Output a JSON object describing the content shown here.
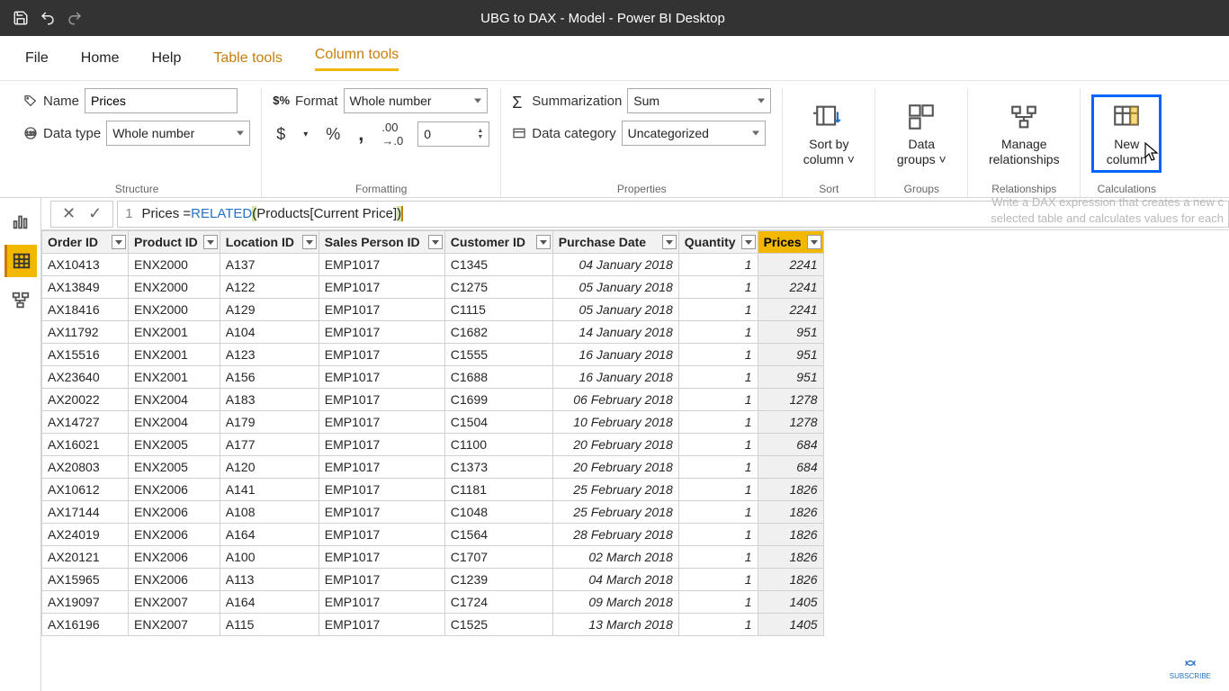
{
  "titlebar": {
    "title": "UBG to DAX - Model - Power BI Desktop"
  },
  "menu": {
    "file": "File",
    "home": "Home",
    "help": "Help",
    "table_tools": "Table tools",
    "column_tools": "Column tools"
  },
  "ribbon": {
    "structure": {
      "label": "Structure",
      "name_label": "Name",
      "name_value": "Prices",
      "datatype_label": "Data type",
      "datatype_value": "Whole number"
    },
    "formatting": {
      "label": "Formatting",
      "format_label": "Format",
      "format_value": "Whole number",
      "currency": "$",
      "percent": "%",
      "comma": ",",
      "decimals_value": "0"
    },
    "properties": {
      "label": "Properties",
      "summarization_label": "Summarization",
      "summarization_value": "Sum",
      "datacategory_label": "Data category",
      "datacategory_value": "Uncategorized"
    },
    "sort": {
      "label": "Sort",
      "button": "Sort by\ncolumn"
    },
    "groups": {
      "label": "Groups",
      "button": "Data\ngroups"
    },
    "relationships": {
      "label": "Relationships",
      "button": "Manage\nrelationships"
    },
    "calculations": {
      "label": "Calculations",
      "button": "New\ncolumn"
    }
  },
  "tooltip": {
    "l1": "Write a DAX expression that creates a new c",
    "l2": "selected table and calculates values for each"
  },
  "formula": {
    "line_no": "1",
    "text_left": "Prices = ",
    "fn": "RELATED",
    "paren_open": "(",
    "arg": " Products[Current Price] ",
    "paren_close": ")"
  },
  "columns": [
    "Order ID",
    "Product ID",
    "Location ID",
    "Sales Person ID",
    "Customer ID",
    "Purchase Date",
    "Quantity",
    "Prices"
  ],
  "rows": [
    [
      "AX10413",
      "ENX2000",
      "A137",
      "EMP1017",
      "C1345",
      "04 January 2018",
      "1",
      "2241"
    ],
    [
      "AX13849",
      "ENX2000",
      "A122",
      "EMP1017",
      "C1275",
      "05 January 2018",
      "1",
      "2241"
    ],
    [
      "AX18416",
      "ENX2000",
      "A129",
      "EMP1017",
      "C1115",
      "05 January 2018",
      "1",
      "2241"
    ],
    [
      "AX11792",
      "ENX2001",
      "A104",
      "EMP1017",
      "C1682",
      "14 January 2018",
      "1",
      "951"
    ],
    [
      "AX15516",
      "ENX2001",
      "A123",
      "EMP1017",
      "C1555",
      "16 January 2018",
      "1",
      "951"
    ],
    [
      "AX23640",
      "ENX2001",
      "A156",
      "EMP1017",
      "C1688",
      "16 January 2018",
      "1",
      "951"
    ],
    [
      "AX20022",
      "ENX2004",
      "A183",
      "EMP1017",
      "C1699",
      "06 February 2018",
      "1",
      "1278"
    ],
    [
      "AX14727",
      "ENX2004",
      "A179",
      "EMP1017",
      "C1504",
      "10 February 2018",
      "1",
      "1278"
    ],
    [
      "AX16021",
      "ENX2005",
      "A177",
      "EMP1017",
      "C1100",
      "20 February 2018",
      "1",
      "684"
    ],
    [
      "AX20803",
      "ENX2005",
      "A120",
      "EMP1017",
      "C1373",
      "20 February 2018",
      "1",
      "684"
    ],
    [
      "AX10612",
      "ENX2006",
      "A141",
      "EMP1017",
      "C1181",
      "25 February 2018",
      "1",
      "1826"
    ],
    [
      "AX17144",
      "ENX2006",
      "A108",
      "EMP1017",
      "C1048",
      "25 February 2018",
      "1",
      "1826"
    ],
    [
      "AX24019",
      "ENX2006",
      "A164",
      "EMP1017",
      "C1564",
      "28 February 2018",
      "1",
      "1826"
    ],
    [
      "AX20121",
      "ENX2006",
      "A100",
      "EMP1017",
      "C1707",
      "02 March 2018",
      "1",
      "1826"
    ],
    [
      "AX15965",
      "ENX2006",
      "A113",
      "EMP1017",
      "C1239",
      "04 March 2018",
      "1",
      "1826"
    ],
    [
      "AX19097",
      "ENX2007",
      "A164",
      "EMP1017",
      "C1724",
      "09 March 2018",
      "1",
      "1405"
    ],
    [
      "AX16196",
      "ENX2007",
      "A115",
      "EMP1017",
      "C1525",
      "13 March 2018",
      "1",
      "1405"
    ]
  ],
  "subscribe": "SUBSCRIBE"
}
